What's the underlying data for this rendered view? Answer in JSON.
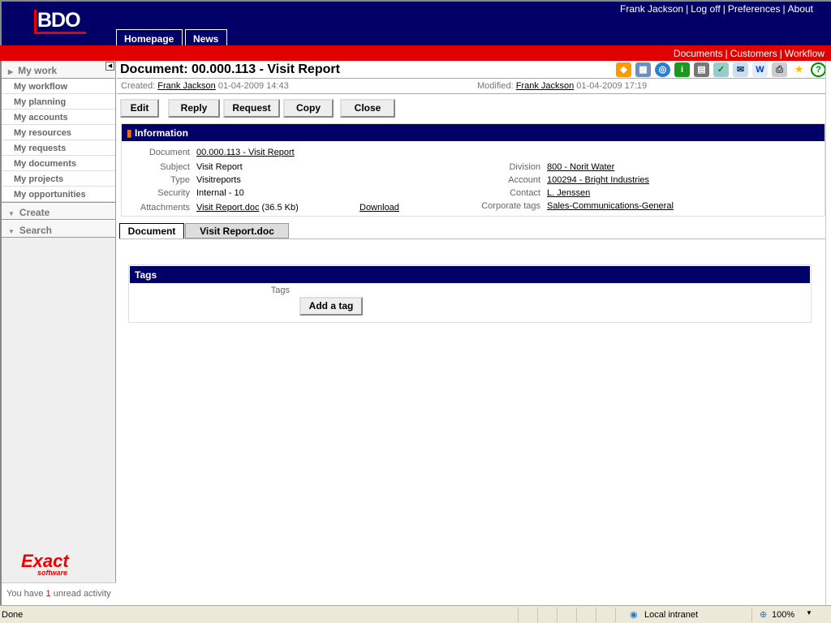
{
  "header": {
    "logo": "BDO",
    "user_menu": [
      "Frank Jackson",
      "Log off",
      "Preferences",
      "About"
    ],
    "tabs": [
      "Homepage",
      "News"
    ],
    "red_links": [
      "Documents",
      "Customers",
      "Workflow"
    ]
  },
  "sidebar": {
    "my_work": "My work",
    "items": [
      "My workflow",
      "My planning",
      "My accounts",
      "My resources",
      "My requests",
      "My documents",
      "My projects",
      "My opportunities"
    ],
    "create": "Create",
    "search": "Search",
    "brand": "Exact",
    "brand_sub": "software",
    "unread_prefix": "You have",
    "unread_count": "1",
    "unread_suffix": "unread activity"
  },
  "document": {
    "title": "Document: 00.000.113 - Visit Report",
    "created_label": "Created:",
    "created_by": "Frank Jackson",
    "created_at": "01-04-2009 14:43",
    "modified_label": "Modified:",
    "modified_by": "Frank Jackson",
    "modified_at": "01-04-2009 17:19"
  },
  "toolbar": [
    "Edit",
    "Reply",
    "Request",
    "Copy",
    "Close"
  ],
  "toolbar_icons": [
    "fish-icon",
    "calendar-icon",
    "cd-icon",
    "info-icon",
    "database-icon",
    "checklist-icon",
    "new-mail-icon",
    "word-icon",
    "print-icon",
    "favorite-icon",
    "help-icon"
  ],
  "info": {
    "heading": "Information",
    "document_label": "Document",
    "document": "00.000.113 - Visit Report",
    "subject_label": "Subject",
    "subject": "Visit Report",
    "type_label": "Type",
    "type": "Visitreports",
    "security_label": "Security",
    "security": "Internal - 10",
    "attachments_label": "Attachments",
    "attachment": "Visit Report.doc",
    "attachment_size": "(36.5 Kb)",
    "download": "Download",
    "division_label": "Division",
    "division": "800 - Norit Water",
    "account_label": "Account",
    "account": "100294 - Bright Industries",
    "contact_label": "Contact",
    "contact": "L. Jenssen",
    "corporate_tags_label": "Corporate tags",
    "corporate_tags": "Sales-Communications-General"
  },
  "tabs": [
    "Document",
    "Visit Report.doc"
  ],
  "tags": {
    "heading": "Tags",
    "label": "Tags",
    "add_button": "Add a tag"
  },
  "statusbar": {
    "status": "Done",
    "zone": "Local intranet",
    "zoom": "100%"
  }
}
